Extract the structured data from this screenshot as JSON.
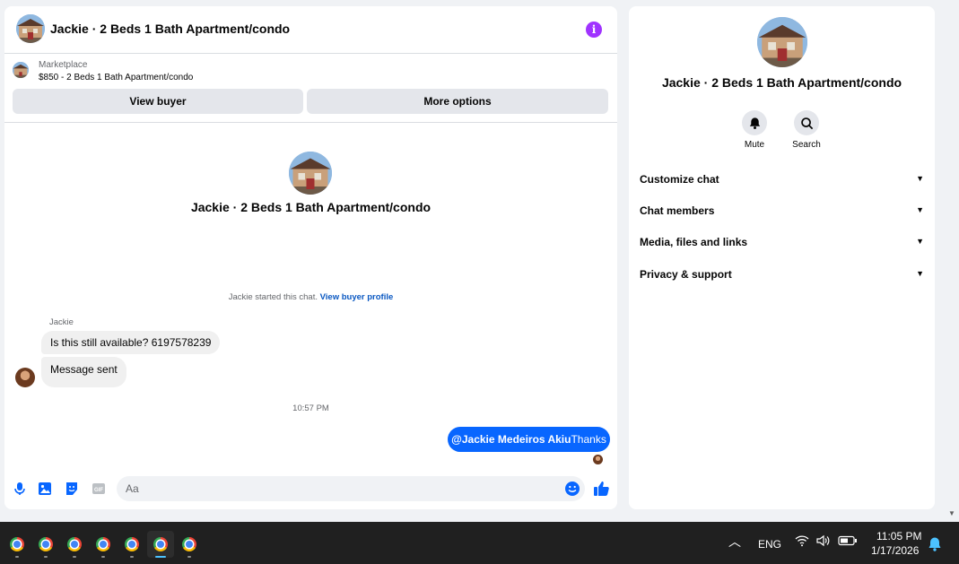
{
  "chat": {
    "header_title": "Jackie · 2 Beds 1 Bath Apartment/condo",
    "info_icon": "i",
    "marketplace_label": "Marketplace",
    "listing_title": "$850 - 2 Beds 1 Bath Apartment/condo",
    "view_buyer": "View buyer",
    "more_options": "More options",
    "profile_name": "Jackie · 2 Beds 1 Bath Apartment/condo",
    "started_text": "Jackie started this chat.",
    "view_profile_link": "View buyer profile",
    "sender": "Jackie",
    "messages_in": [
      "Is this still available? 6197578239",
      "Message sent"
    ],
    "timestamp": "10:57 PM",
    "out_mention": "@Jackie Medeiros Akiu",
    "out_text": "Thanks",
    "composer_placeholder": "Aa"
  },
  "info_panel": {
    "name": "Jackie · 2 Beds 1 Bath Apartment/condo",
    "actions": [
      {
        "label": "Mute",
        "icon": "bell-icon"
      },
      {
        "label": "Search",
        "icon": "search-icon"
      }
    ],
    "sections": [
      "Customize chat",
      "Chat members",
      "Media, files and links",
      "Privacy & support"
    ]
  },
  "taskbar": {
    "apps": [
      "chrome",
      "chrome",
      "chrome",
      "chrome",
      "chrome",
      "chrome",
      "chrome"
    ],
    "active_index": 5,
    "language": "ENG",
    "time": "11:05 PM",
    "date": "1/17/2026"
  },
  "colors": {
    "accent": "#0866ff",
    "info": "#a033ff",
    "background": "#f0f2f5",
    "taskbar": "#202020"
  }
}
